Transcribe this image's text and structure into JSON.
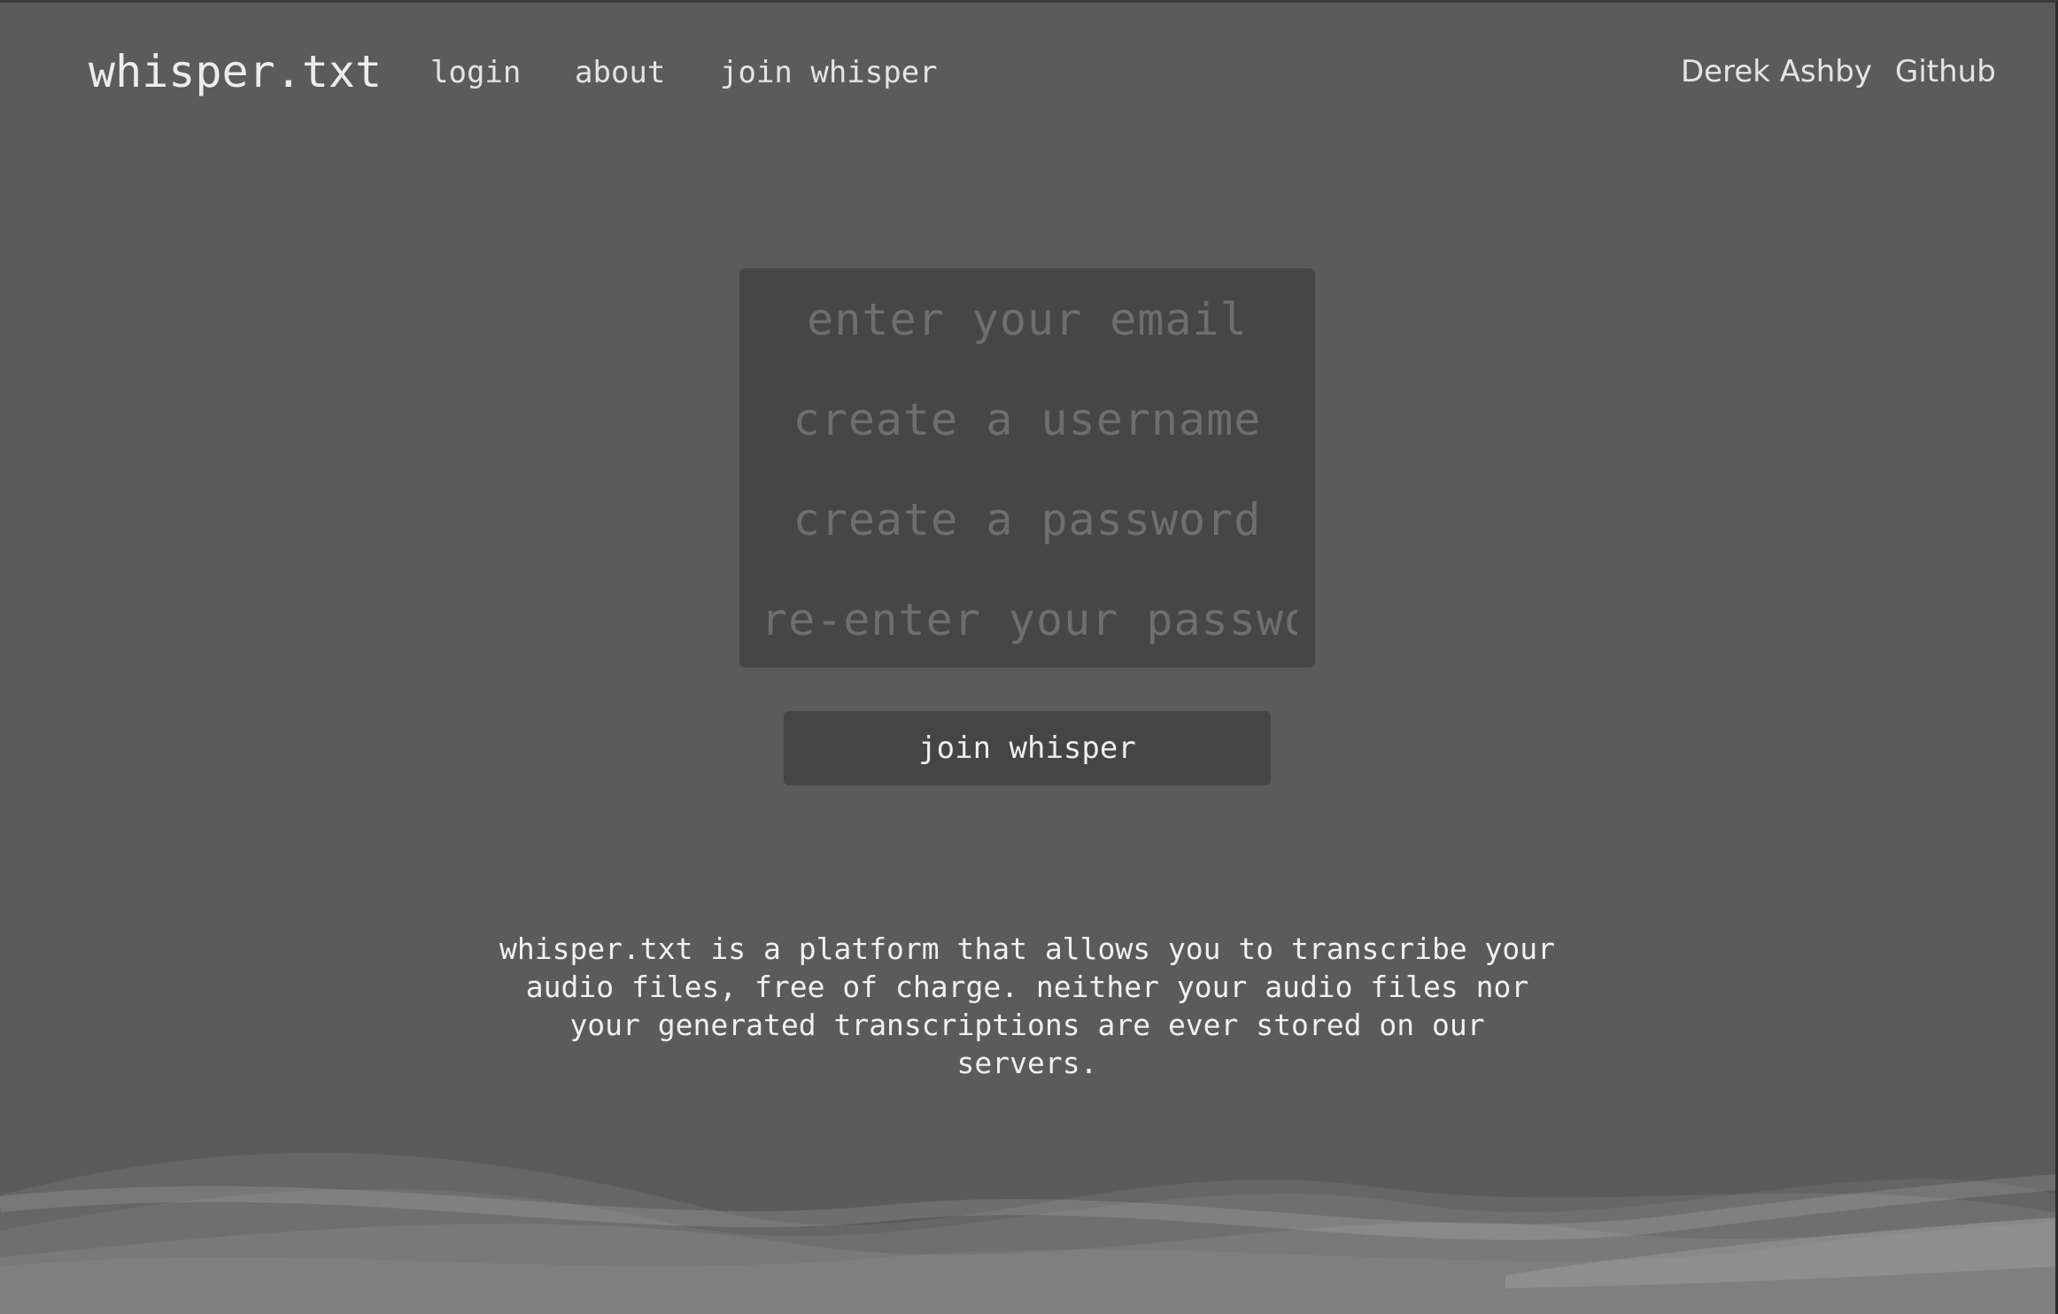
{
  "nav": {
    "brand": "whisper.txt",
    "links": [
      {
        "label": "login"
      },
      {
        "label": "about"
      },
      {
        "label": "join whisper"
      }
    ],
    "right_links": [
      {
        "label": "Derek Ashby"
      },
      {
        "label": "Github"
      }
    ]
  },
  "form": {
    "email_placeholder": "enter your email",
    "username_placeholder": "create a username",
    "password_placeholder": "create a password",
    "confirm_password_placeholder": "re-enter your password",
    "submit_label": "join whisper"
  },
  "description": "whisper.txt is a platform that allows you to transcribe your audio files, free of charge. neither your audio files nor your generated transcriptions are ever stored on our servers.",
  "colors": {
    "background": "#5b5b5b",
    "panel": "#464646",
    "text": "#e9e9e9",
    "placeholder": "#6e6e6e"
  }
}
